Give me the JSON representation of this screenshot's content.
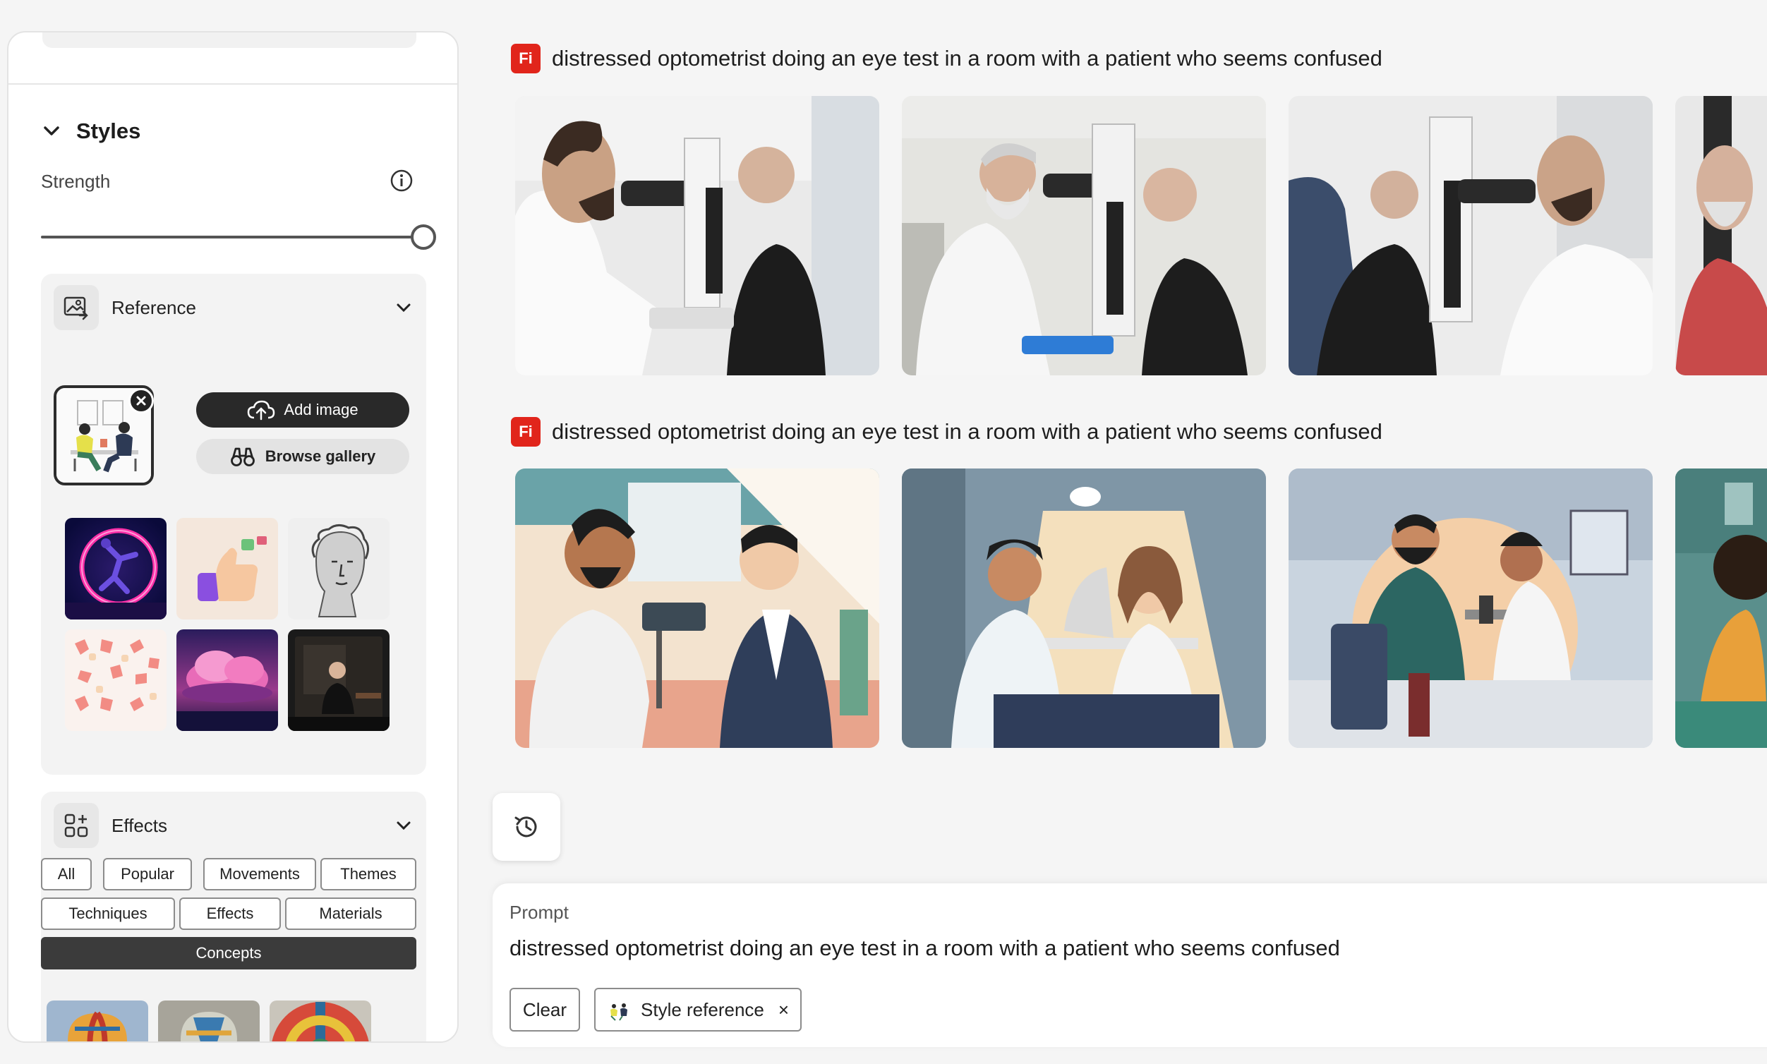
{
  "sidebar": {
    "styles": {
      "title": "Styles",
      "strength_label": "Strength",
      "strength_value": 1.0
    },
    "reference": {
      "title": "Reference",
      "add_image_label": "Add image",
      "browse_gallery_label": "Browse gallery",
      "thumbnails": [
        "neon-figure",
        "thumbs-up-3d",
        "classical-sketch",
        "hands-pattern",
        "pink-clouds",
        "man-at-desk"
      ]
    },
    "effects": {
      "title": "Effects",
      "chips": [
        {
          "label": "All",
          "active": false
        },
        {
          "label": "Popular",
          "active": false
        },
        {
          "label": "Movements",
          "active": false
        },
        {
          "label": "Themes",
          "active": false
        },
        {
          "label": "Techniques",
          "active": false
        },
        {
          "label": "Effects",
          "active": false
        },
        {
          "label": "Materials",
          "active": false
        },
        {
          "label": "Concepts",
          "active": true
        }
      ],
      "thumbnails": [
        "hot-air-balloon-1",
        "hot-air-balloon-2",
        "hot-air-balloon-3"
      ]
    }
  },
  "results": [
    {
      "badge": "Fi",
      "prompt": "distressed optometrist doing an eye test in a room with a patient who seems confused",
      "style": "photo"
    },
    {
      "badge": "Fi",
      "prompt": "distressed optometrist doing an eye test in a room with a patient who seems confused",
      "style": "illustration"
    }
  ],
  "prompt_panel": {
    "label": "Prompt",
    "text": "distressed optometrist doing an eye test in a room with a patient who seems confused",
    "clear_label": "Clear",
    "style_reference_label": "Style reference",
    "remove_symbol": "×"
  },
  "colors": {
    "accent_red": "#e1251b",
    "dark_button": "#292929",
    "active_chip": "#3b3b3b"
  }
}
